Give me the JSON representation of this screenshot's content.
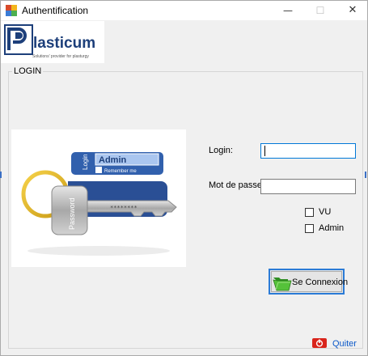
{
  "window": {
    "title": "Authentification"
  },
  "titlebar": {
    "minimize_glyph": "—",
    "maximize_glyph": "☐",
    "close_glyph": "✕"
  },
  "logo": {
    "brand": "lasticum",
    "tagline": "Solutions' provider for plasturgy"
  },
  "group": {
    "title": "LOGIN"
  },
  "illustration": {
    "tag_top": "Login",
    "tag_field": "Admin",
    "tag_remember": "Remember me",
    "key_label": "Password",
    "key_stars": "********"
  },
  "form": {
    "login_label": "Login:",
    "login_value": "",
    "password_label": "Mot de passe:",
    "password_value": "",
    "vu_label": "VU",
    "vu_checked": false,
    "admin_label": "Admin",
    "admin_checked": false
  },
  "buttons": {
    "connect_label": "Se Connexion",
    "connect_icon": "folder-open-icon"
  },
  "footer": {
    "quit_label": "Quiter",
    "quit_icon": "power-icon"
  },
  "colors": {
    "accent": "#0078d7",
    "link": "#0b58c8",
    "logo_blue": "#1d3f7a",
    "quit_red": "#d9241b",
    "folder_green": "#3fae2a"
  }
}
